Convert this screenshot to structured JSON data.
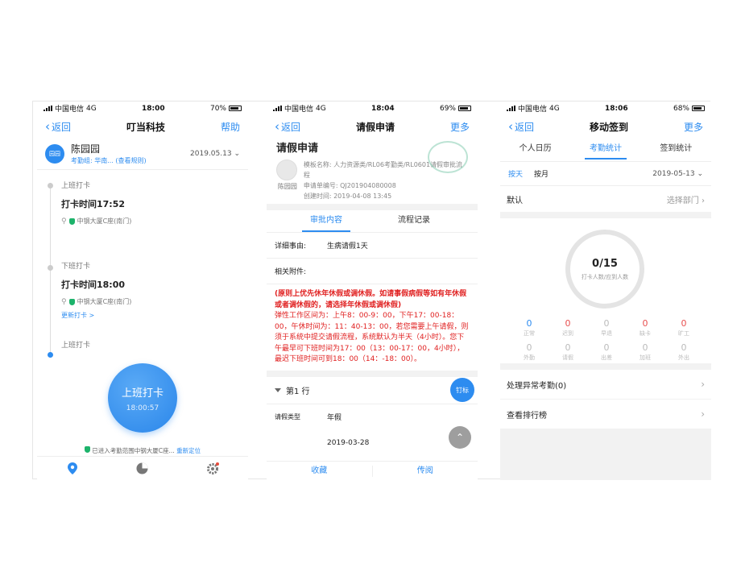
{
  "phone1": {
    "status": {
      "carrier": "中国电信",
      "network": "4G",
      "time": "18:00",
      "battery": "70%"
    },
    "nav": {
      "back": "返回",
      "title": "叮当科技",
      "right": "帮助"
    },
    "user": {
      "avatar_text": "园园",
      "name": "陈园园",
      "group": "考勤组: 华南... (查看规则)",
      "date": "2019.05.13"
    },
    "checkin": {
      "label": "上班打卡",
      "time": "打卡时间17:52",
      "location": "中钢大厦C座(南门)"
    },
    "checkout": {
      "label": "下班打卡",
      "time": "打卡时间18:00",
      "location": "中钢大厦C座(南门)",
      "link": "更新打卡 >"
    },
    "next": {
      "label": "上班打卡"
    },
    "button": {
      "title": "上班打卡",
      "clock": "18:00:57"
    },
    "range": {
      "message": "已进入考勤范围中钢大厦C座...",
      "relocate": "重新定位"
    }
  },
  "phone2": {
    "status": {
      "carrier": "中国电信",
      "network": "4G",
      "time": "18:04",
      "battery": "69%"
    },
    "nav": {
      "back": "返回",
      "title": "请假申请",
      "right": "更多"
    },
    "form": {
      "title": "请假申请",
      "avatar_name": "陈园园",
      "template": "模板名称: 人力资源类/RL06考勤类/RL0601请假审批流程",
      "number": "申请单编号: QJ201904080008",
      "created": "创建时间: 2019-04-08 13:45"
    },
    "tabs": [
      "审批内容",
      "流程记录"
    ],
    "detail_label": "详细事由:",
    "detail_value": "生病请假1天",
    "attachment_label": "相关附件:",
    "notice_bold": "(原则上优先休年休假或调休假。如请事假病假等如有年休假或者调休假的，请选择年休假或调休假)",
    "notice_body": "弹性工作区间为：上午8：00-9：00，下午17：00-18：00，午休时间为：11：40-13：00，若您需要上午请假，则须于系统中提交请假流程，系统默认为半天（4小时）。您下午最早可下班时间为17：00（13：00-17：00，4小时），最迟下班时间可到18：00（14：-18：00）。",
    "row_label": "第1 行",
    "leave_type_label": "请假类型",
    "leave_type_value": "年假",
    "date_value": "2019-03-28",
    "nail_button": "钉标",
    "bottom": {
      "collect": "收藏",
      "forward": "传阅"
    }
  },
  "phone3": {
    "status": {
      "carrier": "中国电信",
      "network": "4G",
      "time": "18:06",
      "battery": "68%"
    },
    "nav": {
      "back": "返回",
      "title": "移动签到",
      "right": "更多"
    },
    "tabs": [
      "个人日历",
      "考勤统计",
      "签到统计"
    ],
    "period": {
      "day": "按天",
      "month": "按月",
      "date": "2019-05-13"
    },
    "dept": {
      "label": "默认",
      "pick": "选择部门"
    },
    "ring": {
      "value": "0/15",
      "caption": "打卡人数/应到人数"
    },
    "stats": [
      {
        "n": "0",
        "l": "正常"
      },
      {
        "n": "0",
        "l": "迟到"
      },
      {
        "n": "0",
        "l": "早退"
      },
      {
        "n": "0",
        "l": "缺卡"
      },
      {
        "n": "0",
        "l": "旷工"
      },
      {
        "n": "0",
        "l": "外勤"
      },
      {
        "n": "0",
        "l": "请假"
      },
      {
        "n": "0",
        "l": "出差"
      },
      {
        "n": "0",
        "l": "加班"
      },
      {
        "n": "0",
        "l": "外出"
      }
    ],
    "rows": {
      "abnormal": "处理异常考勤(0)",
      "rank": "查看排行榜"
    }
  },
  "colors": {
    "accent": "#2d8cf0",
    "danger": "#e02020",
    "success": "#1db36b"
  }
}
